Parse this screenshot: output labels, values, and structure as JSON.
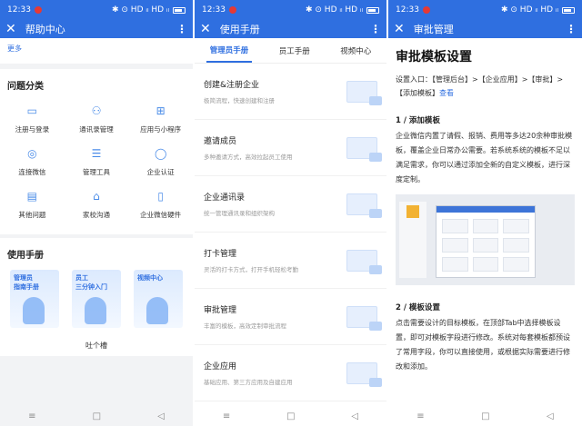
{
  "status": {
    "time": "12:33",
    "signals": "✱ ⊙ HD ᵢₗ HD ᵢₗ"
  },
  "panel1": {
    "title": "帮助中心",
    "more": "更多",
    "section1": "问题分类",
    "grid": [
      {
        "label": "注册与登录",
        "icon": "id-card-icon"
      },
      {
        "label": "通讯录管理",
        "icon": "org-chart-icon"
      },
      {
        "label": "应用与小程序",
        "icon": "apps-grid-icon"
      },
      {
        "label": "连接微信",
        "icon": "wechat-icon"
      },
      {
        "label": "管理工具",
        "icon": "sliders-icon"
      },
      {
        "label": "企业认证",
        "icon": "shield-icon"
      },
      {
        "label": "其他问题",
        "icon": "chart-doc-icon"
      },
      {
        "label": "家校沟通",
        "icon": "graduation-cap-icon"
      },
      {
        "label": "企业微信硬件",
        "icon": "device-icon"
      }
    ],
    "section2": "使用手册",
    "manuals": [
      {
        "line1": "管理员",
        "line2": "指南手册"
      },
      {
        "line1": "员工",
        "line2": "三分钟入门"
      },
      {
        "line1": "视频中心",
        "line2": ""
      }
    ],
    "feedback": "吐个槽"
  },
  "panel2": {
    "title": "使用手册",
    "tabs": [
      "管理员手册",
      "员工手册",
      "视频中心"
    ],
    "items": [
      {
        "title": "创建&注册企业",
        "sub": "极简流程，快速创建和注册"
      },
      {
        "title": "邀请成员",
        "sub": "多种邀请方式，高效拉起员工使用"
      },
      {
        "title": "企业通讯录",
        "sub": "统一管理通讯录和组织架构"
      },
      {
        "title": "打卡管理",
        "sub": "灵活的打卡方式，打开手机轻松考勤"
      },
      {
        "title": "审批管理",
        "sub": "丰富的模板，高效定制审批流程"
      },
      {
        "title": "企业应用",
        "sub": "基础应用、第三方应用及自建应用"
      }
    ]
  },
  "panel3": {
    "title": "审批管理",
    "heading": "审批模板设置",
    "path": "设置入口：【管理后台】>【企业应用】>【审批】>【添加模板】",
    "path_link": "查看",
    "step1_title": "1 / 添加模板",
    "step1_text": "企业微信内置了请假、报销、费用等多达20余种审批模板，覆盖企业日常办公需要。若系统系统的模板不足以满足需求，你可以通过添加全新的自定义模板，进行深度定制。",
    "step2_title": "2 / 模板设置",
    "step2_text": "点击需要设计的目标模板，在顶部Tab中选择模板设置，即可对模板字段进行修改。系统对每套模板都预设了常用字段，你可以直接使用，或根据实际需要进行修改和添加。"
  },
  "colors": {
    "accent": "#2f6fe0"
  }
}
